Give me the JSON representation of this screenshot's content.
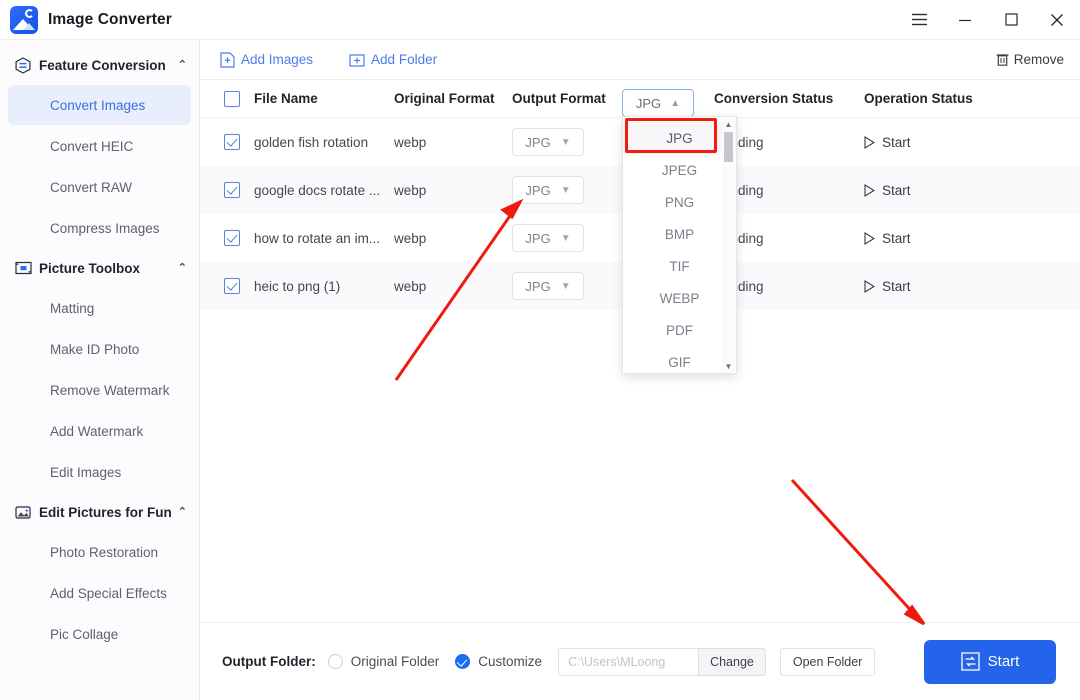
{
  "window": {
    "title": "Image Converter",
    "controls": [
      {
        "name": "menu-button",
        "glyph": "☰"
      },
      {
        "name": "minimize-button",
        "glyph": "—"
      },
      {
        "name": "maximize-button",
        "glyph": "□"
      },
      {
        "name": "close-button",
        "glyph": "✕"
      }
    ]
  },
  "sidebar": {
    "groups": [
      {
        "label": "Feature Conversion",
        "icon": "conversion-icon",
        "caret": "⌃",
        "items": [
          {
            "label": "Convert Images",
            "active": true
          },
          {
            "label": "Convert HEIC",
            "active": false
          },
          {
            "label": "Convert RAW",
            "active": false
          },
          {
            "label": "Compress Images",
            "active": false
          }
        ]
      },
      {
        "label": "Picture Toolbox",
        "icon": "toolbox-icon",
        "caret": "⌃",
        "items": [
          {
            "label": "Matting",
            "active": false
          },
          {
            "label": "Make ID Photo",
            "active": false
          },
          {
            "label": "Remove Watermark",
            "active": false
          },
          {
            "label": "Add Watermark",
            "active": false
          },
          {
            "label": "Edit Images",
            "active": false
          }
        ]
      },
      {
        "label": "Edit Pictures for Fun",
        "icon": "fun-edit-icon",
        "caret": "⌃",
        "items": [
          {
            "label": "Photo Restoration",
            "active": false
          },
          {
            "label": "Add Special Effects",
            "active": false
          },
          {
            "label": "Pic Collage",
            "active": false
          }
        ]
      }
    ]
  },
  "toolbar": {
    "add_images_label": "Add Images",
    "add_folder_label": "Add Folder",
    "remove_label": "Remove"
  },
  "table": {
    "headers": {
      "file_name": "File Name",
      "original_format": "Original Format",
      "output_format": "Output Format",
      "conversion_status": "Conversion Status",
      "operation_status": "Operation Status"
    },
    "header_format_select": {
      "value": "JPG",
      "caret": "⌃"
    },
    "rows": [
      {
        "file_name": "golden fish rotation",
        "original_format": "webp",
        "output_format": "JPG",
        "conversion_status": "Pending",
        "operation": "Start",
        "checked": true
      },
      {
        "file_name": "google docs rotate ...",
        "original_format": "webp",
        "output_format": "JPG",
        "conversion_status": "Pending",
        "operation": "Start",
        "checked": true
      },
      {
        "file_name": "how to rotate an im...",
        "original_format": "webp",
        "output_format": "JPG",
        "conversion_status": "Pending",
        "operation": "Start",
        "checked": true
      },
      {
        "file_name": "heic to png (1)",
        "original_format": "webp",
        "output_format": "JPG",
        "conversion_status": "Pending",
        "operation": "Start",
        "checked": true
      }
    ]
  },
  "dropdown": {
    "selected": "JPG",
    "options": [
      "JPG",
      "JPEG",
      "PNG",
      "BMP",
      "TIF",
      "WEBP",
      "PDF",
      "GIF"
    ]
  },
  "bottom": {
    "output_folder_label": "Output Folder:",
    "original_folder_label": "Original Folder",
    "customize_label": "Customize",
    "path_placeholder": "C:\\Users\\MLoong",
    "change_label": "Change",
    "open_folder_label": "Open Folder",
    "start_label": "Start",
    "selected_option": "Customize"
  },
  "colors": {
    "accent": "#2563eb",
    "link": "#4b7bec",
    "active_nav_bg": "#e8eefc",
    "active_nav_text": "#3b6fe0",
    "annotation_red": "#f01c10"
  }
}
